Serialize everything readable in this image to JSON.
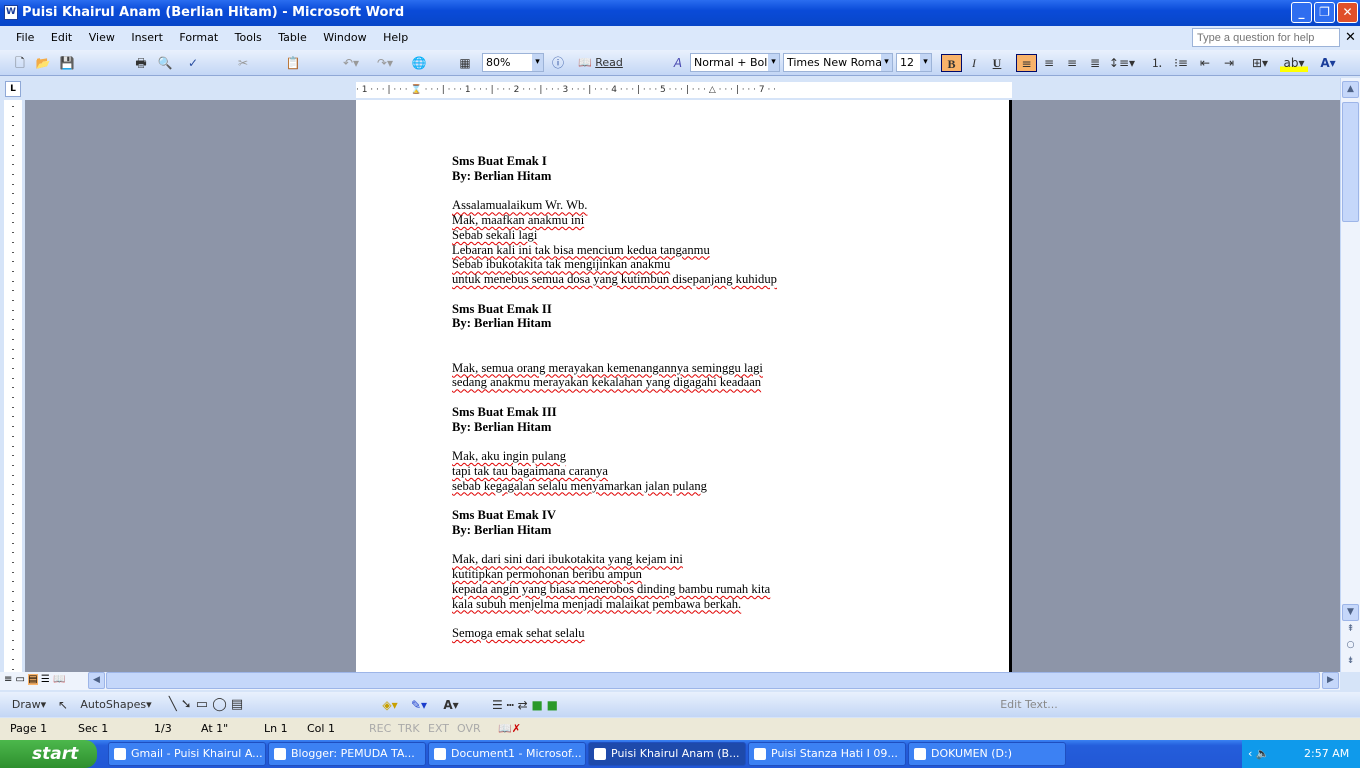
{
  "window": {
    "title": "Puisi Khairul Anam (Berlian Hitam) - Microsoft Word",
    "app_icon": "word-icon",
    "controls": [
      "minimize",
      "restore",
      "close"
    ]
  },
  "menu": [
    "File",
    "Edit",
    "View",
    "Insert",
    "Format",
    "Tools",
    "Table",
    "Window",
    "Help"
  ],
  "help_box": {
    "placeholder": "Type a question for help"
  },
  "toolbar": {
    "zoom": "80%",
    "read_label": "Read",
    "style": "Normal + Bold",
    "font": "Times New Roman",
    "size": "12",
    "bold": "B",
    "italic": "I",
    "underline": "U"
  },
  "ruler": {
    "marks": "· 1 · · · | · · · ⌛ · · · | · · · 1 · · · | · · · 2 · · · | · · · 3 · · · | · · · 4 · · · | · · · 5 · · · | · · · △ · · · | · · · 7 · ·"
  },
  "document": {
    "lines": [
      {
        "t": "Sms Buat Emak I",
        "b": true
      },
      {
        "t": "By: Berlian Hitam",
        "b": true
      },
      {
        "t": ""
      },
      {
        "t": "Assalamualaikum Wr. Wb."
      },
      {
        "t": "Mak, maafkan anakmu ini"
      },
      {
        "t": "Sebab sekali lagi"
      },
      {
        "t": "Lebaran kali ini tak bisa mencium kedua tanganmu"
      },
      {
        "t": "Sebab ibukotakita tak mengijinkan anakmu"
      },
      {
        "t": "untuk menebus semua dosa yang kutimbun disepanjang kuhidup"
      },
      {
        "t": ""
      },
      {
        "t": "Sms Buat Emak II",
        "b": true
      },
      {
        "t": "By: Berlian Hitam",
        "b": true
      },
      {
        "t": ""
      },
      {
        "t": ""
      },
      {
        "t": "Mak, semua orang merayakan kemenangannya seminggu lagi"
      },
      {
        "t": "sedang anakmu merayakan kekalahan yang digagahi keadaan"
      },
      {
        "t": ""
      },
      {
        "t": "Sms Buat Emak III",
        "b": true
      },
      {
        "t": "By: Berlian Hitam",
        "b": true
      },
      {
        "t": ""
      },
      {
        "t": "Mak, aku ingin pulang"
      },
      {
        "t": "tapi tak tau bagaimana caranya"
      },
      {
        "t": "sebab kegagalan selalu menyamarkan jalan pulang"
      },
      {
        "t": ""
      },
      {
        "t": "Sms Buat Emak IV",
        "b": true
      },
      {
        "t": "By: Berlian Hitam",
        "b": true
      },
      {
        "t": ""
      },
      {
        "t": "Mak, dari sini dari ibukotakita yang kejam ini"
      },
      {
        "t": "kutitipkan permohonan beribu ampun"
      },
      {
        "t": "kepada angin yang biasa menerobos dinding bambu rumah kita"
      },
      {
        "t": "kala subuh menjelma menjadi malaikat pembawa berkah."
      },
      {
        "t": ""
      },
      {
        "t": "Semoga emak sehat selalu"
      }
    ]
  },
  "drawing": {
    "draw": "Draw",
    "autoshapes": "AutoShapes",
    "edit_text": "Edit Text..."
  },
  "status": {
    "page": "Page 1",
    "sec": "Sec 1",
    "pages": "1/3",
    "at": "At 1\"",
    "ln": "Ln 1",
    "col": "Col 1",
    "rec": "REC",
    "trk": "TRK",
    "ext": "EXT",
    "ovr": "OVR"
  },
  "taskbar": {
    "start": "start",
    "items": [
      {
        "label": "Gmail - Puisi Khairul A...",
        "active": false
      },
      {
        "label": "Blogger: PEMUDA TA...",
        "active": false
      },
      {
        "label": "Document1 - Microsof...",
        "active": false
      },
      {
        "label": "Puisi Khairul Anam (B...",
        "active": true
      },
      {
        "label": "Puisi Stanza Hati I 09...",
        "active": false
      },
      {
        "label": "DOKUMEN (D:)",
        "active": false
      }
    ],
    "clock": "2:57 AM"
  },
  "colors": {
    "title": "#0a4bd8",
    "active_button": "#f9b36a",
    "doc_bg": "#8d95a8",
    "spell_underline": "#e00000"
  }
}
